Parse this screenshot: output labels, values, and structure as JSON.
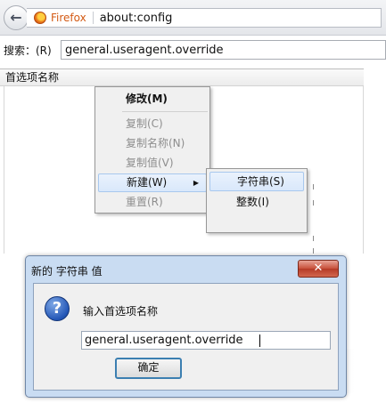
{
  "browser": {
    "brand_label": "Firefox",
    "address": "about:config"
  },
  "search": {
    "label": "搜索：(R)",
    "value": "general.useragent.override"
  },
  "table": {
    "column_header": "首选项名称"
  },
  "context_menu": {
    "items": [
      {
        "label": "修改(M)"
      },
      {
        "label": "复制(C)"
      },
      {
        "label": "复制名称(N)"
      },
      {
        "label": "复制值(V)"
      },
      {
        "label": "新建(W)"
      },
      {
        "label": "重置(R)"
      }
    ],
    "submenu_arrow": "▶"
  },
  "submenu": {
    "items": [
      {
        "label": "字符串(S)"
      },
      {
        "label": "整数(I)"
      }
    ]
  },
  "dialog": {
    "title": "新的 字符串 值",
    "close_label": "✕",
    "prompt": "输入首选项名称",
    "input_value": "general.useragent.override",
    "ok_label": "确定",
    "icon_glyph": "?"
  },
  "colors": {
    "dialog_frame": "#c9dcf2",
    "close_button": "#c7503a",
    "menu_highlight": "#d9e8fb",
    "firefox_orange": "#d35a14"
  }
}
